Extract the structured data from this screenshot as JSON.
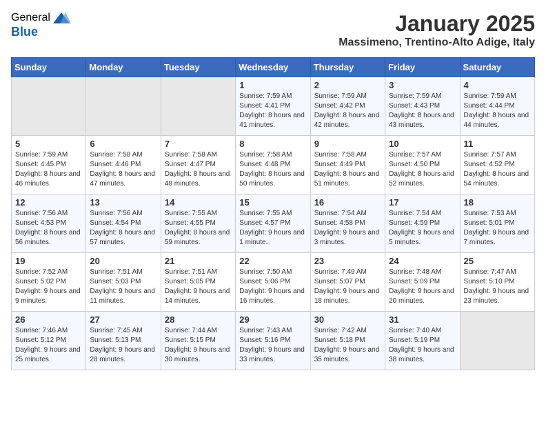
{
  "header": {
    "logo_general": "General",
    "logo_blue": "Blue",
    "month": "January 2025",
    "location": "Massimeno, Trentino-Alto Adige, Italy"
  },
  "weekdays": [
    "Sunday",
    "Monday",
    "Tuesday",
    "Wednesday",
    "Thursday",
    "Friday",
    "Saturday"
  ],
  "weeks": [
    [
      {
        "day": "",
        "info": ""
      },
      {
        "day": "",
        "info": ""
      },
      {
        "day": "",
        "info": ""
      },
      {
        "day": "1",
        "info": "Sunrise: 7:59 AM\nSunset: 4:41 PM\nDaylight: 8 hours and 41 minutes."
      },
      {
        "day": "2",
        "info": "Sunrise: 7:59 AM\nSunset: 4:42 PM\nDaylight: 8 hours and 42 minutes."
      },
      {
        "day": "3",
        "info": "Sunrise: 7:59 AM\nSunset: 4:43 PM\nDaylight: 8 hours and 43 minutes."
      },
      {
        "day": "4",
        "info": "Sunrise: 7:59 AM\nSunset: 4:44 PM\nDaylight: 8 hours and 44 minutes."
      }
    ],
    [
      {
        "day": "5",
        "info": "Sunrise: 7:59 AM\nSunset: 4:45 PM\nDaylight: 8 hours and 46 minutes."
      },
      {
        "day": "6",
        "info": "Sunrise: 7:58 AM\nSunset: 4:46 PM\nDaylight: 8 hours and 47 minutes."
      },
      {
        "day": "7",
        "info": "Sunrise: 7:58 AM\nSunset: 4:47 PM\nDaylight: 8 hours and 48 minutes."
      },
      {
        "day": "8",
        "info": "Sunrise: 7:58 AM\nSunset: 4:48 PM\nDaylight: 8 hours and 50 minutes."
      },
      {
        "day": "9",
        "info": "Sunrise: 7:58 AM\nSunset: 4:49 PM\nDaylight: 8 hours and 51 minutes."
      },
      {
        "day": "10",
        "info": "Sunrise: 7:57 AM\nSunset: 4:50 PM\nDaylight: 8 hours and 52 minutes."
      },
      {
        "day": "11",
        "info": "Sunrise: 7:57 AM\nSunset: 4:52 PM\nDaylight: 8 hours and 54 minutes."
      }
    ],
    [
      {
        "day": "12",
        "info": "Sunrise: 7:56 AM\nSunset: 4:53 PM\nDaylight: 8 hours and 56 minutes."
      },
      {
        "day": "13",
        "info": "Sunrise: 7:56 AM\nSunset: 4:54 PM\nDaylight: 8 hours and 57 minutes."
      },
      {
        "day": "14",
        "info": "Sunrise: 7:55 AM\nSunset: 4:55 PM\nDaylight: 8 hours and 59 minutes."
      },
      {
        "day": "15",
        "info": "Sunrise: 7:55 AM\nSunset: 4:57 PM\nDaylight: 9 hours and 1 minute."
      },
      {
        "day": "16",
        "info": "Sunrise: 7:54 AM\nSunset: 4:58 PM\nDaylight: 9 hours and 3 minutes."
      },
      {
        "day": "17",
        "info": "Sunrise: 7:54 AM\nSunset: 4:59 PM\nDaylight: 9 hours and 5 minutes."
      },
      {
        "day": "18",
        "info": "Sunrise: 7:53 AM\nSunset: 5:01 PM\nDaylight: 9 hours and 7 minutes."
      }
    ],
    [
      {
        "day": "19",
        "info": "Sunrise: 7:52 AM\nSunset: 5:02 PM\nDaylight: 9 hours and 9 minutes."
      },
      {
        "day": "20",
        "info": "Sunrise: 7:51 AM\nSunset: 5:03 PM\nDaylight: 9 hours and 11 minutes."
      },
      {
        "day": "21",
        "info": "Sunrise: 7:51 AM\nSunset: 5:05 PM\nDaylight: 9 hours and 14 minutes."
      },
      {
        "day": "22",
        "info": "Sunrise: 7:50 AM\nSunset: 5:06 PM\nDaylight: 9 hours and 16 minutes."
      },
      {
        "day": "23",
        "info": "Sunrise: 7:49 AM\nSunset: 5:07 PM\nDaylight: 9 hours and 18 minutes."
      },
      {
        "day": "24",
        "info": "Sunrise: 7:48 AM\nSunset: 5:09 PM\nDaylight: 9 hours and 20 minutes."
      },
      {
        "day": "25",
        "info": "Sunrise: 7:47 AM\nSunset: 5:10 PM\nDaylight: 9 hours and 23 minutes."
      }
    ],
    [
      {
        "day": "26",
        "info": "Sunrise: 7:46 AM\nSunset: 5:12 PM\nDaylight: 9 hours and 25 minutes."
      },
      {
        "day": "27",
        "info": "Sunrise: 7:45 AM\nSunset: 5:13 PM\nDaylight: 9 hours and 28 minutes."
      },
      {
        "day": "28",
        "info": "Sunrise: 7:44 AM\nSunset: 5:15 PM\nDaylight: 9 hours and 30 minutes."
      },
      {
        "day": "29",
        "info": "Sunrise: 7:43 AM\nSunset: 5:16 PM\nDaylight: 9 hours and 33 minutes."
      },
      {
        "day": "30",
        "info": "Sunrise: 7:42 AM\nSunset: 5:18 PM\nDaylight: 9 hours and 35 minutes."
      },
      {
        "day": "31",
        "info": "Sunrise: 7:40 AM\nSunset: 5:19 PM\nDaylight: 9 hours and 38 minutes."
      },
      {
        "day": "",
        "info": ""
      }
    ]
  ]
}
